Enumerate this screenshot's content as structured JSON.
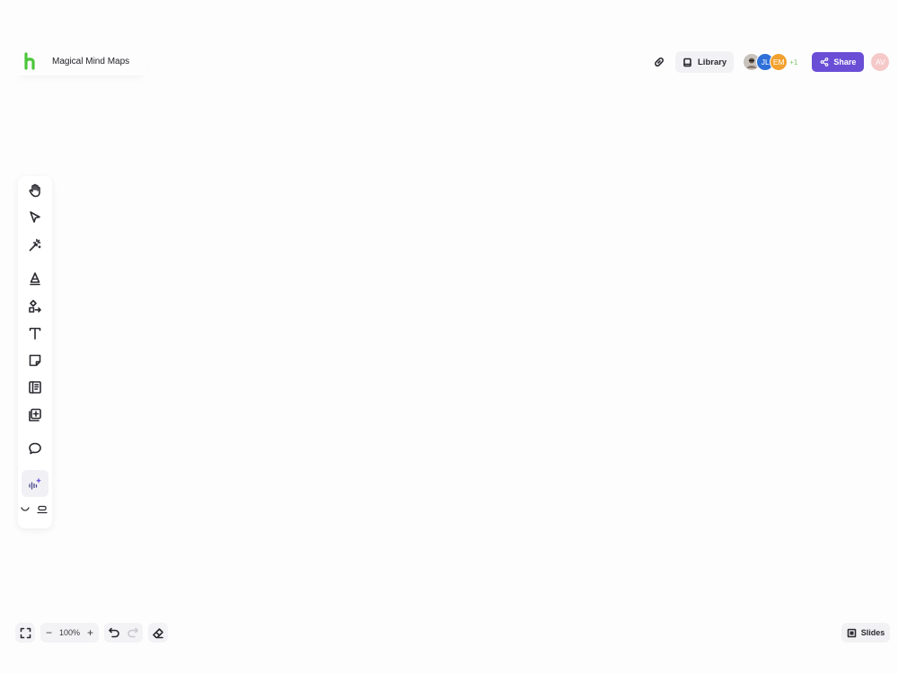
{
  "app": {
    "board_title": "Magical Mind Maps"
  },
  "header": {
    "library_label": "Library",
    "collaborators": [
      {
        "initials": "",
        "color": "#c8c2bc",
        "type": "photo"
      },
      {
        "initials": "JL",
        "color": "#2e6fd8"
      },
      {
        "initials": "EM",
        "color": "#f2a12e"
      }
    ],
    "more_collaborators": "+1",
    "share_label": "Share",
    "user_initials": "AV",
    "user_color": "#f6c9c9",
    "accent_color": "#6a4fd6",
    "logo_color": "#4cc63a"
  },
  "toolbar": {
    "tools": [
      {
        "name": "hand-icon"
      },
      {
        "name": "select-cursor-icon"
      },
      {
        "name": "magic-wand-icon"
      },
      {
        "name": "pen-icon"
      },
      {
        "name": "shapes-arrow-icon"
      },
      {
        "name": "text-icon"
      },
      {
        "name": "sticky-note-icon"
      },
      {
        "name": "template-icon"
      },
      {
        "name": "add-content-icon"
      },
      {
        "name": "comment-icon"
      },
      {
        "name": "ai-sparkle-icon"
      }
    ]
  },
  "footer": {
    "zoom_level": "100%",
    "zoom_out": "−",
    "zoom_in": "+",
    "slides_label": "Slides"
  }
}
